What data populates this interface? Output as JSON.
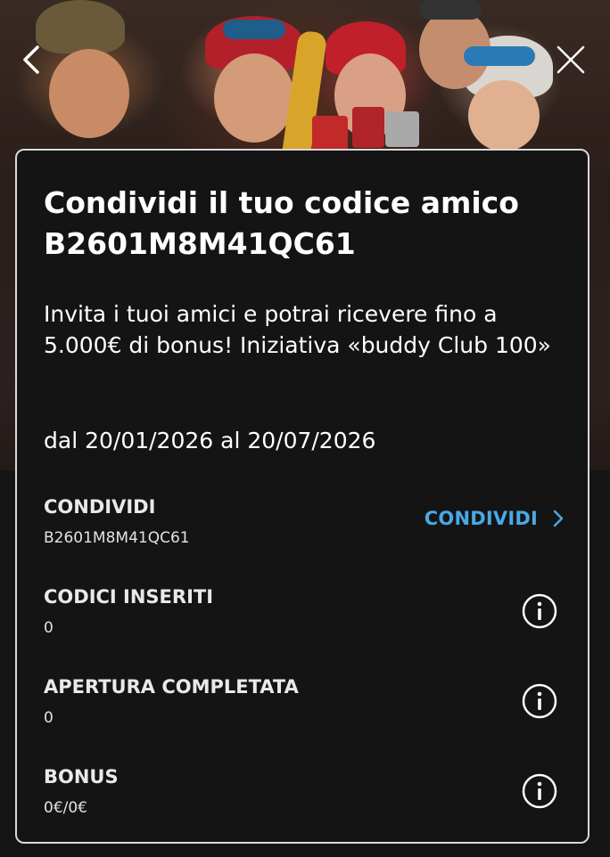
{
  "header": {
    "back_icon": "chevron-left-icon",
    "close_icon": "close-icon"
  },
  "card": {
    "title": "Condividi il tuo codice amico B2601M8M41QC61",
    "description": "Invita i tuoi amici e potrai ricevere fino a 5.000€ di bonus! Iniziativa «buddy Club 100»",
    "period": "dal 20/01/2026 al 20/07/2026"
  },
  "rows": {
    "share": {
      "label": "CONDIVIDI",
      "value": "B2601M8M41QC61",
      "action_label": "CONDIVIDI",
      "action_icon": "chevron-right-icon"
    },
    "codes": {
      "label": "CODICI INSERITI",
      "value": "0",
      "icon": "info-icon"
    },
    "opening": {
      "label": "APERTURA COMPLETATA",
      "value": "0",
      "icon": "info-icon"
    },
    "bonus": {
      "label": "BONUS",
      "value": "0€/0€",
      "icon": "info-icon"
    }
  },
  "colors": {
    "accent": "#4aa8e6",
    "card_background": "#141414",
    "card_border": "#d9d9d9",
    "text": "#ffffff"
  }
}
